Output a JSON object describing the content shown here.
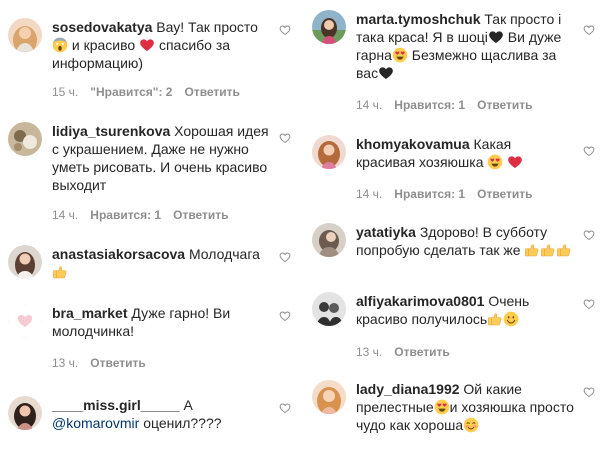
{
  "comments_left": [
    {
      "user": "sosedovakatya",
      "text_1": " Вау! Так просто ",
      "text_2": " и красиво ",
      "text_3": " спасибо за информацию)",
      "time": "15 ч.",
      "likes": "\"Нравится\": 2",
      "reply": "Ответить"
    },
    {
      "user": "lidiya_tsurenkova",
      "text": " Хорошая идея с украшением. Даже не нужно уметь рисовать. И очень красиво выходит",
      "time": "14 ч.",
      "likes": "Нравится: 1",
      "reply": "Ответить"
    },
    {
      "user": "anastasiakorsacova",
      "text": " Молодчага "
    },
    {
      "user": "bra_market",
      "text": " Дуже гарно! Ви молодчинка!",
      "time": "13 ч.",
      "reply": "Ответить"
    },
    {
      "user": "____miss.girl_____",
      "text_1": " А ",
      "mention": "@komarovmir",
      "text_2": " оценил????"
    }
  ],
  "comments_right": [
    {
      "user": "marta.tymoshchuk",
      "text_1": " Так просто і така краса! Я в шоці",
      "text_2": " Ви дуже гарна",
      "text_3": " Безмежно щаслива за вас",
      "time": "14 ч.",
      "likes": "Нравится: 1",
      "reply": "Ответить"
    },
    {
      "user": "khomyakovamua",
      "text": " Какая красивая хозяюшка ",
      "time": "14 ч.",
      "likes": "Нравится: 1",
      "reply": "Ответить"
    },
    {
      "user": "yatatiyka",
      "text": " Здорово! В субботу попробую сделать так же "
    },
    {
      "user": "alfiyakarimova0801",
      "text": " Очень красиво получилось",
      "time": "13 ч.",
      "reply": "Ответить"
    },
    {
      "user": "lady_diana1992",
      "text_1": " Ой какие прелестные",
      "text_2": "и хозяюшка просто чудо как хороша"
    }
  ],
  "colors": {
    "username": "#262626",
    "meta": "#8e8e8e",
    "mention": "#00376b",
    "heart_outline": "#8e8e8e",
    "heart_emoji": "#ed4956"
  },
  "icons": [
    "heart-outline-icon",
    "scream-emoji-icon",
    "red-heart-emoji-icon",
    "heart-eyes-emoji-icon",
    "thumbs-up-emoji-icon",
    "smile-emoji-icon",
    "black-heart-emoji-icon",
    "blush-emoji-icon"
  ]
}
